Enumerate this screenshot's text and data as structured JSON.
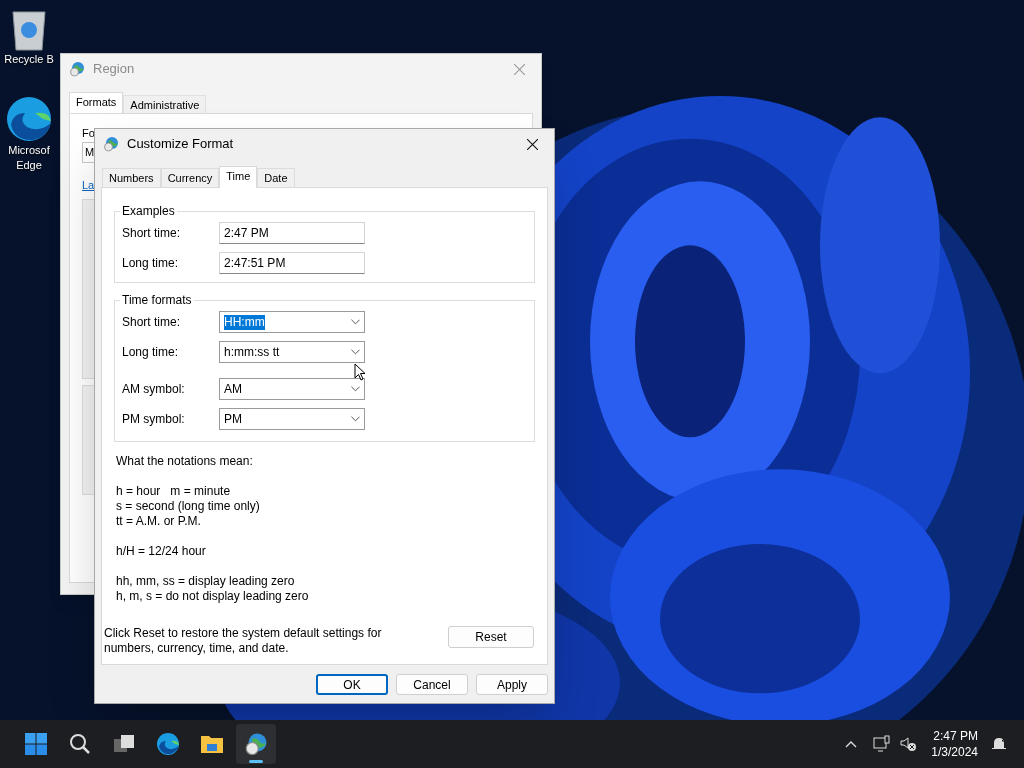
{
  "desktop_icons": [
    {
      "kind": "recycle",
      "lines": [
        "Recycle B"
      ]
    },
    {
      "kind": "edge",
      "lines": [
        "Microsof",
        "Edge"
      ]
    }
  ],
  "region_window": {
    "title": "Region",
    "tabs": [
      {
        "label": "Formats",
        "selected": true
      },
      {
        "label": "Administrative",
        "selected": false
      }
    ],
    "format_label": "Fo",
    "format_value": "M",
    "link": "La"
  },
  "dialog": {
    "title": "Customize Format",
    "tabs": [
      {
        "label": "Numbers",
        "selected": false
      },
      {
        "label": "Currency",
        "selected": false
      },
      {
        "label": "Time",
        "selected": true
      },
      {
        "label": "Date",
        "selected": false
      }
    ],
    "examples": {
      "title": "Examples",
      "rows": [
        {
          "label": "Short time:",
          "value": "2:47 PM"
        },
        {
          "label": "Long time:",
          "value": "2:47:51 PM"
        }
      ]
    },
    "time_formats": {
      "title": "Time formats",
      "rows": [
        {
          "label": "Short time:",
          "value": "HH:mm",
          "text_selected": true
        },
        {
          "label": "Long time:",
          "value": "h:mm:ss tt",
          "text_selected": false
        },
        {
          "label": "AM symbol:",
          "value": "AM",
          "text_selected": false
        },
        {
          "label": "PM symbol:",
          "value": "PM",
          "text_selected": false
        }
      ]
    },
    "notes": [
      [
        "What the notations mean:"
      ],
      [
        "h = hour   m = minute",
        "s = second (long time only)",
        "tt = A.M. or P.M."
      ],
      [
        "h/H = 12/24 hour"
      ],
      [
        "hh, mm, ss = display leading zero",
        "h, m, s = do not display leading zero"
      ]
    ],
    "reset_text": "Click Reset to restore the system default settings for numbers, currency, time, and date.",
    "reset_button": "Reset",
    "buttons": [
      {
        "label": "OK",
        "default": true
      },
      {
        "label": "Cancel",
        "default": false
      },
      {
        "label": "Apply",
        "default": false
      }
    ]
  },
  "taskbar": {
    "apps": [
      {
        "kind": "start",
        "active": false
      },
      {
        "kind": "search",
        "active": false
      },
      {
        "kind": "taskview",
        "active": false
      },
      {
        "kind": "edge",
        "active": false
      },
      {
        "kind": "explorer",
        "active": false
      },
      {
        "kind": "region",
        "active": true
      }
    ],
    "time": "2:47 PM",
    "date": "1/3/2024"
  }
}
